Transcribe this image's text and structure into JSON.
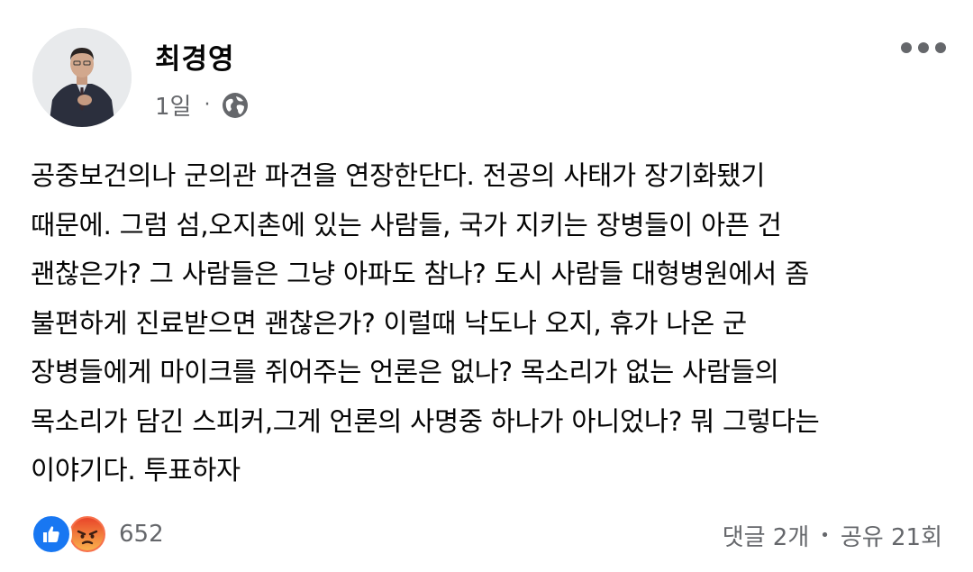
{
  "post": {
    "author": "최경영",
    "timestamp": "1일",
    "separator": "·",
    "privacy_icon": "globe-icon",
    "body": "공중보건의나 군의관 파견을 연장한단다. 전공의 사태가 장기화됐기\n때문에. 그럼 섬,오지촌에 있는 사람들, 국가 지키는 장병들이 아픈 건\n괜찮은가? 그 사람들은 그냥 아파도 참나? 도시 사람들 대형병원에서 좀\n불편하게 진료받으면 괜찮은가? 이럴때 낙도나 오지, 휴가 나온 군\n장병들에게 마이크를 쥐어주는 언론은 없나? 목소리가 없는 사람들의\n목소리가 담긴 스피커,그게 언론의 사명중 하나가 아니었나? 뭐 그렇다는\n이야기다. 투표하자"
  },
  "footer": {
    "reactions": [
      "like-icon",
      "angry-icon"
    ],
    "reaction_count": "652",
    "comments": "댓글 2개",
    "dot": "•",
    "shares": "공유 21회"
  },
  "colors": {
    "like_blue": "#1877f2",
    "angry_orange": "#f7714c",
    "secondary_text": "#65676b",
    "primary_text": "#050505"
  }
}
